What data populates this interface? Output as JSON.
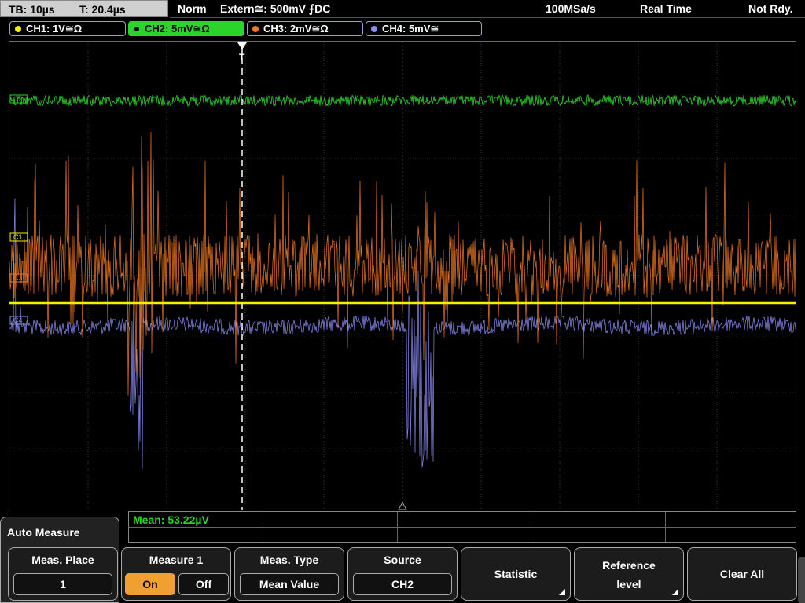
{
  "status": {
    "timebase": "TB: 10µs",
    "trigger_time": "T: 20.4µs",
    "mode": "Norm",
    "trigger": "Extern≅: 500mV ⨍DC",
    "sample_rate": "100MSa/s",
    "acq": "Real Time",
    "state": "Not Rdy."
  },
  "channels": [
    {
      "label": "CH1: 1V≅Ω",
      "color": "#f5f000",
      "active": false
    },
    {
      "label": "CH2: 5mV≅Ω",
      "color": "#2ad42a",
      "active": true
    },
    {
      "label": "CH3: 2mV≅Ω",
      "color": "#f07820",
      "active": false
    },
    {
      "label": "CH4: 5mV≅",
      "color": "#8a8cf0",
      "active": false
    }
  ],
  "markers": {
    "ch1": "C1",
    "ch2": "C2",
    "ch3": "C3",
    "ch4": "C4",
    "trigger": "T"
  },
  "measurement": {
    "mean_text": "Mean: 53.22µV"
  },
  "menu": {
    "title": "Auto Measure"
  },
  "softkeys": {
    "meas_place": {
      "label": "Meas. Place",
      "value": "1"
    },
    "measure1": {
      "label": "Measure 1",
      "on": "On",
      "off": "Off",
      "state": "On"
    },
    "meas_type": {
      "label": "Meas. Type",
      "value": "Mean Value"
    },
    "source": {
      "label": "Source",
      "value": "CH2"
    },
    "statistic": {
      "label": "Statistic"
    },
    "reference": {
      "line1": "Reference",
      "line2": "level"
    },
    "clear_all": {
      "label": "Clear All"
    }
  },
  "colors": {
    "grid": "#5a5a5a",
    "ch1": "#f5f000",
    "ch2": "#2ad42a",
    "ch3": "#f07820",
    "ch4": "#8a8cf0"
  }
}
